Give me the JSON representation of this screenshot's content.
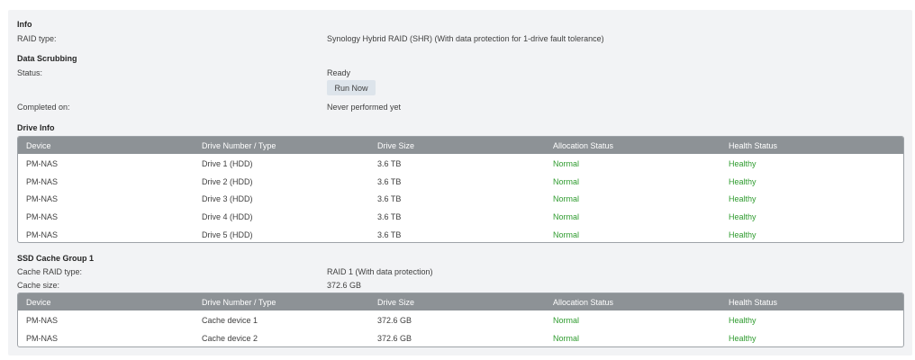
{
  "info": {
    "title": "Info",
    "raid_type_label": "RAID type:",
    "raid_type_value": "Synology Hybrid RAID (SHR) (With data protection for 1-drive fault tolerance)"
  },
  "scrubbing": {
    "title": "Data Scrubbing",
    "status_label": "Status:",
    "status_value": "Ready",
    "run_button": "Run Now",
    "completed_label": "Completed on:",
    "completed_value": "Never performed yet"
  },
  "drive_info": {
    "title": "Drive Info",
    "columns": [
      "Device",
      "Drive Number / Type",
      "Drive Size",
      "Allocation Status",
      "Health Status"
    ],
    "rows": [
      [
        "PM-NAS",
        "Drive 1 (HDD)",
        "3.6 TB",
        "Normal",
        "Healthy"
      ],
      [
        "PM-NAS",
        "Drive 2 (HDD)",
        "3.6 TB",
        "Normal",
        "Healthy"
      ],
      [
        "PM-NAS",
        "Drive 3 (HDD)",
        "3.6 TB",
        "Normal",
        "Healthy"
      ],
      [
        "PM-NAS",
        "Drive 4 (HDD)",
        "3.6 TB",
        "Normal",
        "Healthy"
      ],
      [
        "PM-NAS",
        "Drive 5 (HDD)",
        "3.6 TB",
        "Normal",
        "Healthy"
      ]
    ]
  },
  "ssd_cache": {
    "title": "SSD Cache Group 1",
    "raid_type_label": "Cache RAID type:",
    "raid_type_value": "RAID 1 (With data protection)",
    "size_label": "Cache size:",
    "size_value": "372.6 GB",
    "columns": [
      "Device",
      "Drive Number / Type",
      "Drive Size",
      "Allocation Status",
      "Health Status"
    ],
    "rows": [
      [
        "PM-NAS",
        "Cache device 1",
        "372.6 GB",
        "Normal",
        "Healthy"
      ],
      [
        "PM-NAS",
        "Cache device 2",
        "372.6 GB",
        "Normal",
        "Healthy"
      ]
    ]
  },
  "colors": {
    "status_green": "#2e9b2e",
    "header_gray": "#8d9296",
    "panel_bg": "#f2f3f5"
  }
}
